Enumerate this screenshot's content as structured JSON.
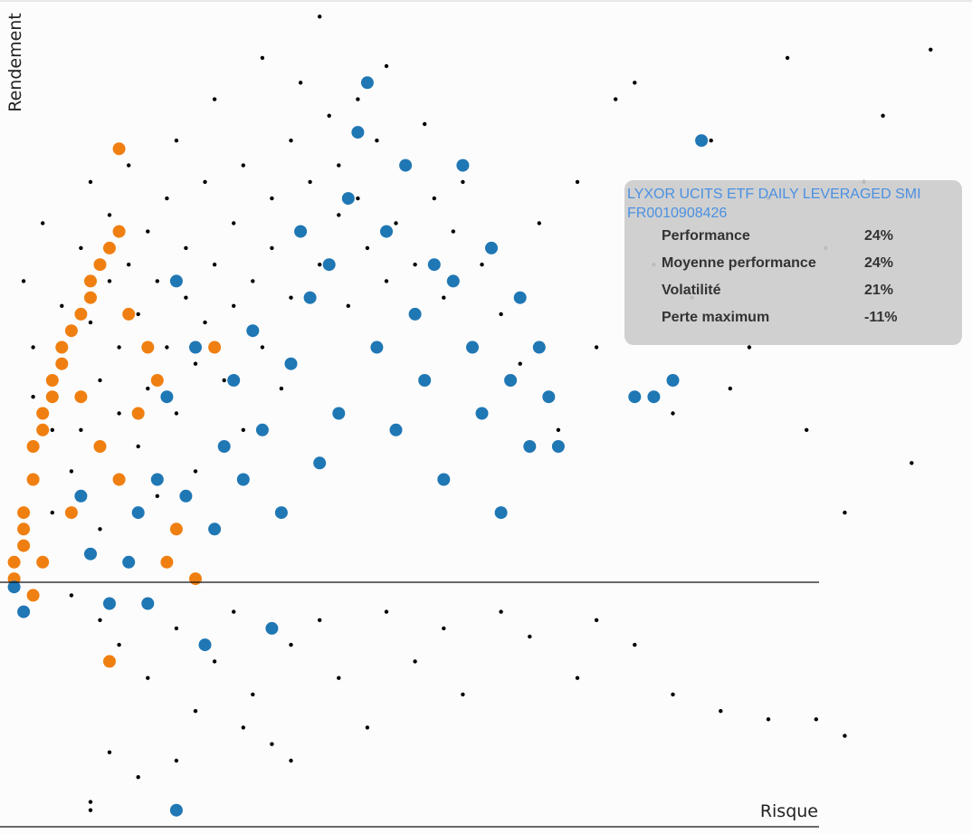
{
  "chart_data": {
    "type": "scatter",
    "xlabel": "Risque",
    "ylabel": "Rendement",
    "xlim": [
      0,
      100
    ],
    "ylim": [
      -28,
      72
    ],
    "grid": false,
    "series": [
      {
        "color": "#000000",
        "points": [
          [
            2,
            38
          ],
          [
            3,
            30
          ],
          [
            3,
            24
          ],
          [
            4,
            45
          ],
          [
            5,
            20
          ],
          [
            5,
            10
          ],
          [
            6,
            35
          ],
          [
            6,
            28
          ],
          [
            7,
            15
          ],
          [
            8,
            42
          ],
          [
            8,
            20
          ],
          [
            9,
            50
          ],
          [
            9,
            33
          ],
          [
            10,
            26
          ],
          [
            10,
            8
          ],
          [
            11,
            38
          ],
          [
            11,
            46
          ],
          [
            12,
            22
          ],
          [
            12,
            30
          ],
          [
            13,
            52
          ],
          [
            13,
            40
          ],
          [
            14,
            18
          ],
          [
            14,
            34
          ],
          [
            15,
            44
          ],
          [
            15,
            25
          ],
          [
            16,
            12
          ],
          [
            16,
            38
          ],
          [
            17,
            48
          ],
          [
            17,
            30
          ],
          [
            18,
            22
          ],
          [
            18,
            55
          ],
          [
            19,
            36
          ],
          [
            19,
            42
          ],
          [
            20,
            28
          ],
          [
            20,
            15
          ],
          [
            21,
            50
          ],
          [
            21,
            33
          ],
          [
            22,
            40
          ],
          [
            22,
            60
          ],
          [
            23,
            26
          ],
          [
            24,
            45
          ],
          [
            24,
            35
          ],
          [
            25,
            20
          ],
          [
            25,
            52
          ],
          [
            26,
            38
          ],
          [
            27,
            30
          ],
          [
            27,
            65
          ],
          [
            28,
            42
          ],
          [
            28,
            48
          ],
          [
            29,
            25
          ],
          [
            30,
            55
          ],
          [
            30,
            36
          ],
          [
            31,
            62
          ],
          [
            31,
            44
          ],
          [
            32,
            50
          ],
          [
            33,
            40
          ],
          [
            33,
            70
          ],
          [
            34,
            58
          ],
          [
            35,
            46
          ],
          [
            35,
            52
          ],
          [
            36,
            35
          ],
          [
            37,
            60
          ],
          [
            37,
            48
          ],
          [
            38,
            42
          ],
          [
            39,
            55
          ],
          [
            40,
            38
          ],
          [
            40,
            64
          ],
          [
            41,
            45
          ],
          [
            42,
            52
          ],
          [
            43,
            40
          ],
          [
            44,
            57
          ],
          [
            45,
            48
          ],
          [
            46,
            36
          ],
          [
            47,
            44
          ],
          [
            48,
            50
          ],
          [
            50,
            40
          ],
          [
            52,
            34
          ],
          [
            54,
            28
          ],
          [
            56,
            45
          ],
          [
            58,
            20
          ],
          [
            60,
            50
          ],
          [
            62,
            30
          ],
          [
            64,
            60
          ],
          [
            66,
            62
          ],
          [
            68,
            40
          ],
          [
            70,
            22
          ],
          [
            72,
            36
          ],
          [
            74,
            55
          ],
          [
            76,
            25
          ],
          [
            78,
            30
          ],
          [
            80,
            48
          ],
          [
            82,
            65
          ],
          [
            84,
            20
          ],
          [
            86,
            42
          ],
          [
            88,
            10
          ],
          [
            90,
            50
          ],
          [
            92,
            58
          ],
          [
            95,
            16
          ],
          [
            97,
            66
          ],
          [
            7,
            0
          ],
          [
            10,
            -3
          ],
          [
            12,
            -6
          ],
          [
            15,
            -10
          ],
          [
            18,
            -4
          ],
          [
            20,
            -14
          ],
          [
            22,
            -8
          ],
          [
            24,
            -2
          ],
          [
            26,
            -12
          ],
          [
            28,
            -18
          ],
          [
            30,
            -6
          ],
          [
            33,
            -3
          ],
          [
            35,
            -10
          ],
          [
            38,
            -16
          ],
          [
            40,
            -2
          ],
          [
            43,
            -8
          ],
          [
            46,
            -4
          ],
          [
            48,
            -12
          ],
          [
            52,
            -2
          ],
          [
            55,
            -5
          ],
          [
            60,
            -10
          ],
          [
            62,
            -3
          ],
          [
            66,
            -6
          ],
          [
            70,
            -12
          ],
          [
            75,
            -14
          ],
          [
            80,
            -15
          ],
          [
            85,
            -15
          ],
          [
            88,
            -17
          ],
          [
            11,
            -19
          ],
          [
            14,
            -22
          ],
          [
            18,
            -20
          ],
          [
            25,
            -16
          ],
          [
            30,
            -20
          ],
          [
            9,
            -25
          ],
          [
            9,
            -26
          ]
        ]
      },
      {
        "color": "#f07f11",
        "points": [
          [
            1,
            2
          ],
          [
            1,
            4
          ],
          [
            2,
            6
          ],
          [
            2,
            8
          ],
          [
            2,
            10
          ],
          [
            3,
            14
          ],
          [
            3,
            18
          ],
          [
            4,
            20
          ],
          [
            4,
            22
          ],
          [
            5,
            24
          ],
          [
            5,
            26
          ],
          [
            6,
            28
          ],
          [
            6,
            30
          ],
          [
            7,
            32
          ],
          [
            8,
            34
          ],
          [
            9,
            36
          ],
          [
            9,
            38
          ],
          [
            10,
            40
          ],
          [
            11,
            42
          ],
          [
            12,
            44
          ],
          [
            13,
            34
          ],
          [
            14,
            22
          ],
          [
            15,
            30
          ],
          [
            16,
            26
          ],
          [
            17,
            4
          ],
          [
            18,
            8
          ],
          [
            20,
            2
          ],
          [
            22,
            30
          ],
          [
            8,
            24
          ],
          [
            10,
            18
          ],
          [
            4,
            4
          ],
          [
            7,
            10
          ],
          [
            12,
            14
          ],
          [
            3,
            0
          ],
          [
            11,
            -8
          ],
          [
            12,
            54
          ]
        ]
      },
      {
        "color": "#1f77b4",
        "points": [
          [
            1,
            1
          ],
          [
            2,
            -2
          ],
          [
            8,
            12
          ],
          [
            9,
            5
          ],
          [
            11,
            -1
          ],
          [
            13,
            4
          ],
          [
            14,
            10
          ],
          [
            15,
            -1
          ],
          [
            16,
            14
          ],
          [
            17,
            24
          ],
          [
            18,
            38
          ],
          [
            19,
            12
          ],
          [
            20,
            30
          ],
          [
            21,
            -6
          ],
          [
            22,
            8
          ],
          [
            23,
            18
          ],
          [
            24,
            26
          ],
          [
            25,
            14
          ],
          [
            26,
            32
          ],
          [
            27,
            20
          ],
          [
            28,
            -4
          ],
          [
            29,
            10
          ],
          [
            30,
            28
          ],
          [
            31,
            44
          ],
          [
            32,
            36
          ],
          [
            33,
            16
          ],
          [
            34,
            40
          ],
          [
            35,
            22
          ],
          [
            36,
            48
          ],
          [
            37,
            56
          ],
          [
            38,
            62
          ],
          [
            39,
            30
          ],
          [
            40,
            44
          ],
          [
            41,
            20
          ],
          [
            42,
            52
          ],
          [
            43,
            34
          ],
          [
            44,
            26
          ],
          [
            45,
            40
          ],
          [
            46,
            14
          ],
          [
            47,
            38
          ],
          [
            48,
            52
          ],
          [
            49,
            30
          ],
          [
            50,
            22
          ],
          [
            51,
            42
          ],
          [
            52,
            10
          ],
          [
            53,
            26
          ],
          [
            54,
            36
          ],
          [
            55,
            18
          ],
          [
            56,
            30
          ],
          [
            57,
            24
          ],
          [
            58,
            18
          ],
          [
            66,
            24
          ],
          [
            68,
            24
          ],
          [
            70,
            26
          ],
          [
            73,
            55
          ],
          [
            18,
            -26
          ]
        ]
      }
    ],
    "tooltip": {
      "name": "LYXOR UCITS ETF DAILY LEVERAGED SMI",
      "isin": "FR0010908426",
      "rows": [
        {
          "label": "Performance",
          "value": "24%"
        },
        {
          "label": "Moyenne performance",
          "value": "24%"
        },
        {
          "label": "Volatilité",
          "value": "21%"
        },
        {
          "label": "Perte maximum",
          "value": "-11%"
        }
      ]
    }
  }
}
